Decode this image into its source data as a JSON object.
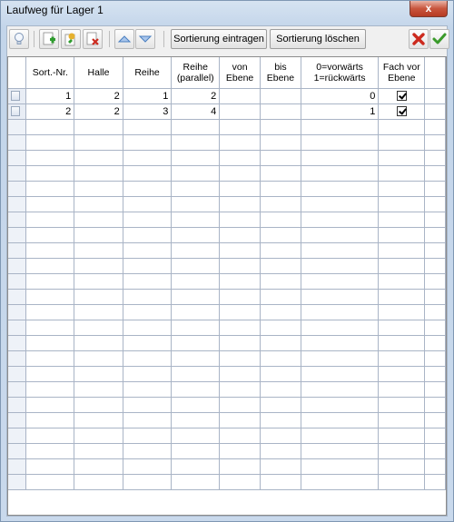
{
  "window": {
    "title": "Laufweg für Lager 1",
    "close_label": "x"
  },
  "toolbar": {
    "sort_enter_label": "Sortierung eintragen",
    "sort_delete_label": "Sortierung löschen"
  },
  "grid": {
    "columns": [
      "",
      "Sort.-Nr.",
      "Halle",
      "Reihe",
      "Reihe\n(parallel)",
      "von\nEbene",
      "bis\nEbene",
      "0=vorwärts\n1=rückwärts",
      "Fach vor\nEbene",
      ""
    ],
    "rows": [
      {
        "sort_nr": "1",
        "halle": "2",
        "reihe": "1",
        "reihe_parallel": "2",
        "von_ebene": "",
        "bis_ebene": "",
        "richtung": "0",
        "fach_vor_ebene": true
      },
      {
        "sort_nr": "2",
        "halle": "2",
        "reihe": "3",
        "reihe_parallel": "4",
        "von_ebene": "",
        "bis_ebene": "",
        "richtung": "1",
        "fach_vor_ebene": true
      }
    ],
    "empty_rows": 24
  },
  "colors": {
    "accent_blue": "#4a7fc0",
    "add_green": "#2e9b2e",
    "delete_red": "#cc2a1e",
    "confirm_green": "#3a9a2a"
  },
  "icons": [
    "lightbulb-icon",
    "add-icon",
    "edit-icon",
    "delete-icon",
    "arrow-up-icon",
    "arrow-down-icon",
    "cancel-icon",
    "confirm-icon"
  ]
}
